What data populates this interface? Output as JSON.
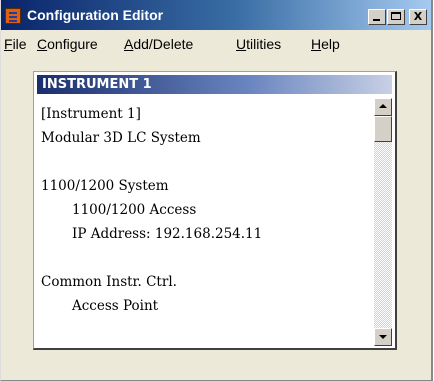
{
  "window": {
    "title": "Configuration Editor",
    "buttons": {
      "minimize": "_",
      "maximize": "",
      "close": "X"
    }
  },
  "menu": {
    "items": [
      {
        "pre": "",
        "accel": "F",
        "post": "ile"
      },
      {
        "pre": "",
        "accel": "C",
        "post": "onfigure"
      },
      {
        "pre": "",
        "accel": "A",
        "post": "dd/Delete"
      },
      {
        "pre": "",
        "accel": "U",
        "post": "tilities"
      },
      {
        "pre": "",
        "accel": "H",
        "post": "elp"
      }
    ]
  },
  "child": {
    "title": "INSTRUMENT 1",
    "lines": [
      "[Instrument 1]",
      "Modular 3D LC System",
      "",
      "1100/1200 System",
      "1100/1200 Access",
      "IP Address: 192.168.254.11",
      "",
      "Common Instr. Ctrl.",
      "Access Point"
    ]
  },
  "colors": {
    "title_bar": "#0a246a",
    "child_title_bar": "#1a2e6e",
    "face": "#ece9d8",
    "app_icon": "#e06010"
  },
  "icons": [
    "app-icon",
    "minimize-icon",
    "maximize-icon",
    "close-icon",
    "scroll-up-arrow-icon",
    "scroll-down-arrow-icon"
  ]
}
